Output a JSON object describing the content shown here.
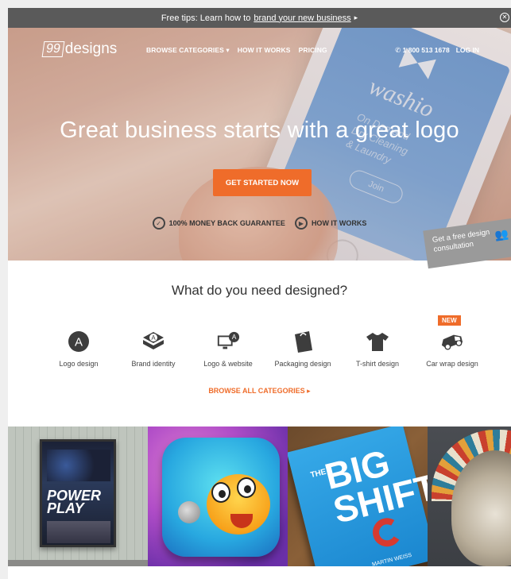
{
  "tipbar": {
    "text": "Free tips: Learn how to",
    "link": "brand your new business",
    "arrow": "▸",
    "close_icon": "close-circle-icon"
  },
  "nav": {
    "logo_box": "99",
    "logo_text": "designs",
    "links": [
      "BROWSE CATEGORIES ▾",
      "HOW IT WORKS",
      "PRICING"
    ],
    "phone": "1 800 513 1678",
    "login": "LOG IN"
  },
  "hero": {
    "headline": "Great business starts with a great logo",
    "cta": "GET STARTED NOW",
    "guarantee": "100% MONEY BACK GUARANTEE",
    "how_it_works": "HOW IT WORKS",
    "phone_brand": "washio",
    "phone_tagline": [
      "On Demand",
      "Dry Cleaning",
      "& Laundry"
    ],
    "phone_button": "Join"
  },
  "consult": {
    "line1": "Get a free design",
    "line2": "consultation"
  },
  "categories": {
    "heading": "What do you need designed?",
    "items": [
      {
        "label": "Logo design",
        "icon": "logo-a-icon"
      },
      {
        "label": "Brand identity",
        "icon": "brand-identity-icon"
      },
      {
        "label": "Logo & website",
        "icon": "monitor-icon"
      },
      {
        "label": "Packaging design",
        "icon": "bag-icon"
      },
      {
        "label": "T-shirt design",
        "icon": "tshirt-icon"
      },
      {
        "label": "Car wrap design",
        "icon": "car-icon"
      }
    ],
    "new_badge": "NEW",
    "browse_all": "BROWSE ALL CATEGORIES ▸"
  },
  "gallery": {
    "poster_title_1": "POWER",
    "poster_title_2": "PLAY",
    "book_prefix": "THE",
    "book_title_1": "BIG",
    "book_title_2": "SHIFT",
    "book_author": "MARTIN WEISS"
  },
  "colors": {
    "accent": "#ef6c2a",
    "tipbar": "#5a5a5a",
    "icon": "#3d3d3d"
  }
}
